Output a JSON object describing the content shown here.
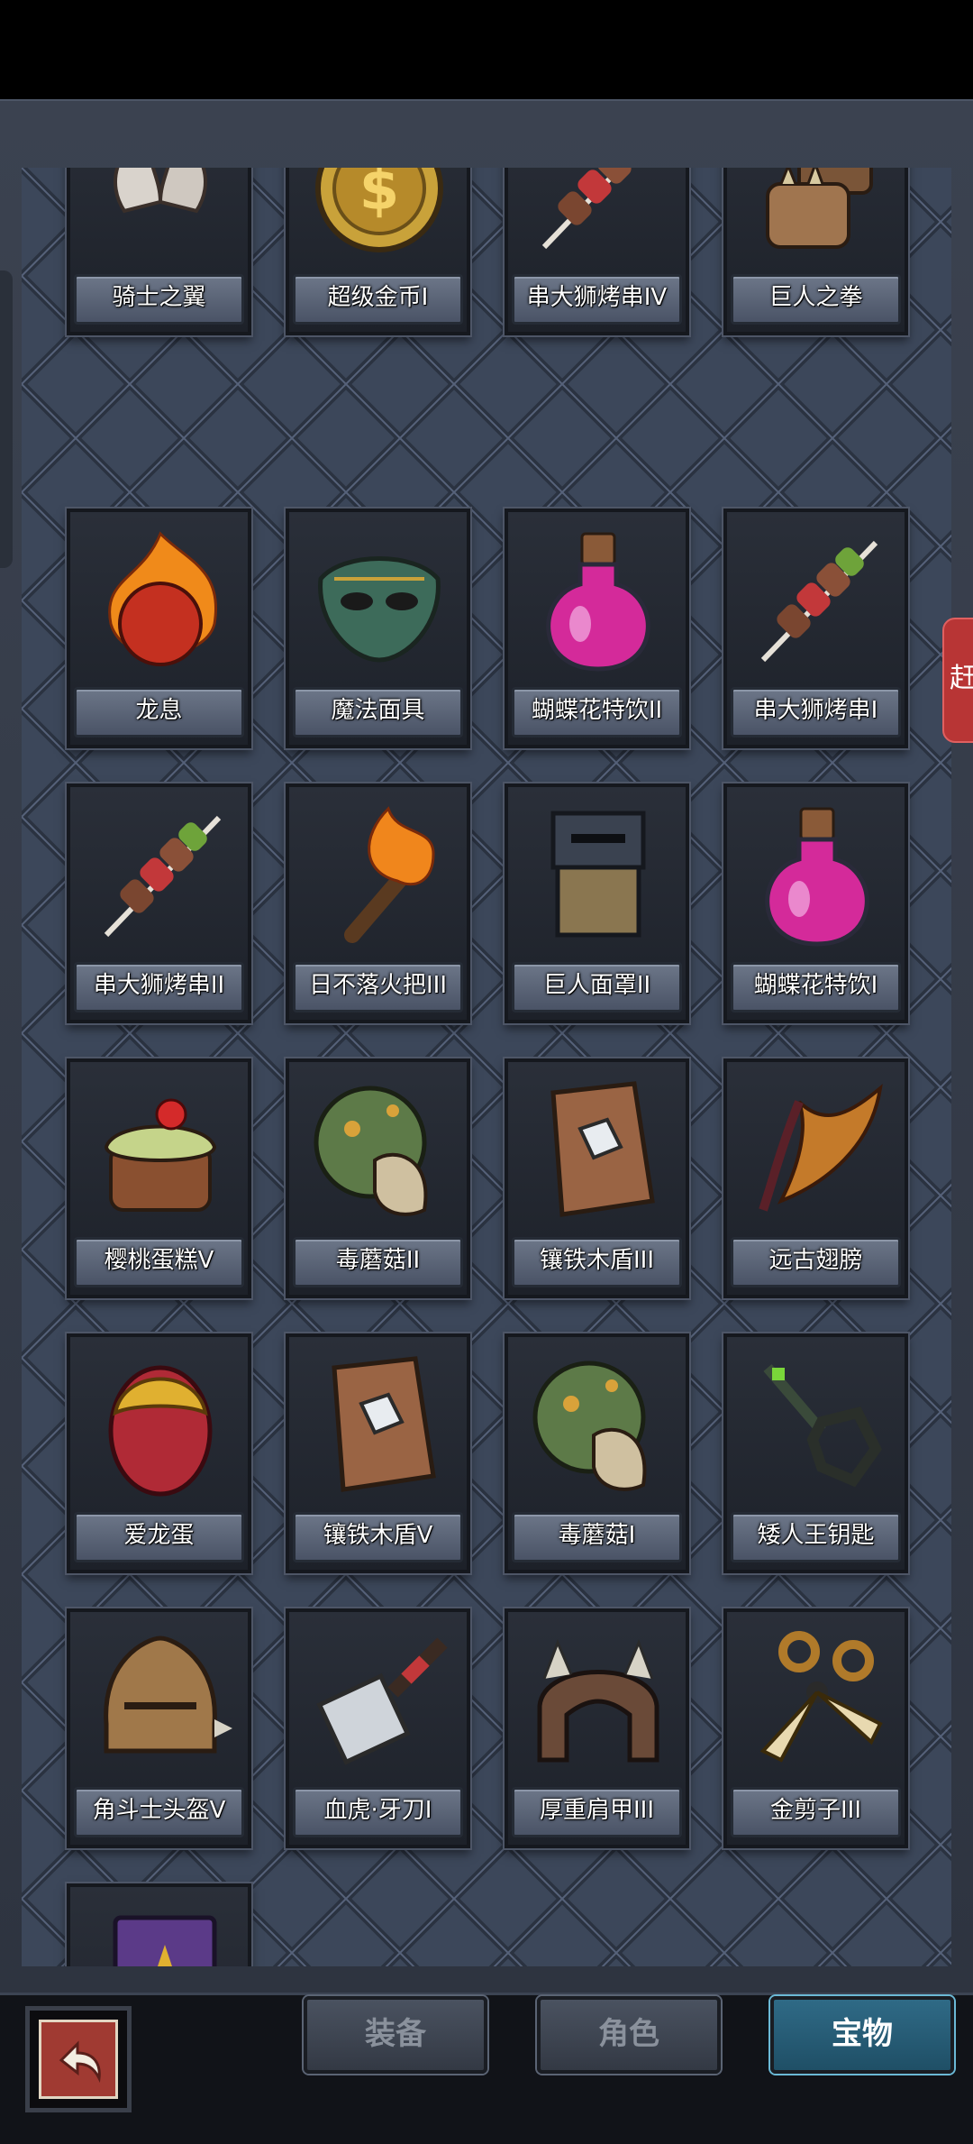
{
  "side_tab_glyph": "赶",
  "items": [
    {
      "name": "骑士之翼",
      "icon": "wings-icon"
    },
    {
      "name": "超级金币I",
      "icon": "gold-coin-icon"
    },
    {
      "name": "串大狮烤串IV",
      "icon": "skewer-icon"
    },
    {
      "name": "巨人之拳",
      "icon": "giant-fist-icon"
    },
    {
      "name": "龙息",
      "icon": "flaming-heart-icon"
    },
    {
      "name": "魔法面具",
      "icon": "magic-mask-icon"
    },
    {
      "name": "蝴蝶花特饮II",
      "icon": "potion-icon"
    },
    {
      "name": "串大狮烤串I",
      "icon": "skewer-icon"
    },
    {
      "name": "串大狮烤串II",
      "icon": "skewer-icon"
    },
    {
      "name": "日不落火把III",
      "icon": "torch-icon"
    },
    {
      "name": "巨人面罩II",
      "icon": "giant-visor-icon"
    },
    {
      "name": "蝴蝶花特饮I",
      "icon": "potion-icon"
    },
    {
      "name": "樱桃蛋糕V",
      "icon": "cherry-cake-icon"
    },
    {
      "name": "毒蘑菇II",
      "icon": "poison-mushroom-icon"
    },
    {
      "name": "镶铁木盾III",
      "icon": "wooden-shield-icon"
    },
    {
      "name": "远古翅膀",
      "icon": "ancient-wing-icon"
    },
    {
      "name": "爱龙蛋",
      "icon": "dragon-egg-icon"
    },
    {
      "name": "镶铁木盾V",
      "icon": "wooden-shield-icon"
    },
    {
      "name": "毒蘑菇I",
      "icon": "poison-mushroom-icon"
    },
    {
      "name": "矮人王钥匙",
      "icon": "dwarf-key-icon"
    },
    {
      "name": "角斗士头盔V",
      "icon": "gladiator-helmet-icon"
    },
    {
      "name": "血虎·牙刀I",
      "icon": "cleaver-icon"
    },
    {
      "name": "厚重肩甲III",
      "icon": "shoulder-armor-icon"
    },
    {
      "name": "金剪子III",
      "icon": "golden-scissors-icon"
    },
    {
      "name": "",
      "icon": "spellbook-icon"
    }
  ],
  "tabs": {
    "equipment": "装备",
    "character": "角色",
    "treasure": "宝物"
  },
  "active_tab": "treasure",
  "colors": {
    "panel_bg": "#3a4558",
    "active_tab": "#2f6a86",
    "back_button": "#a03a32",
    "side_tab": "#b83535"
  }
}
